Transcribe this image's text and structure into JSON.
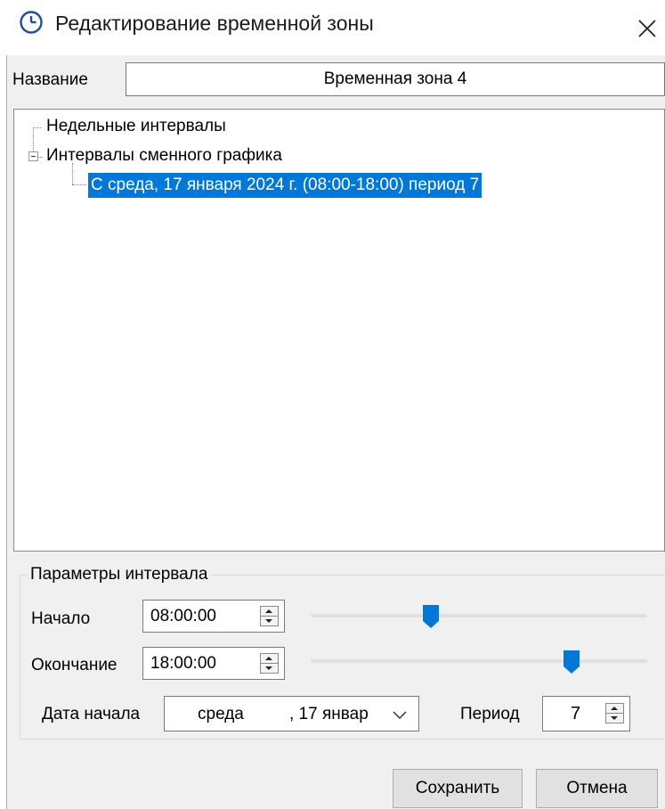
{
  "window": {
    "title": "Редактирование временной зоны",
    "icon": "clock-icon",
    "close_icon": "close-icon"
  },
  "name_field": {
    "label": "Название",
    "value": "Временная зона 4"
  },
  "tree": {
    "nodes": [
      {
        "label": "Недельные интервалы"
      },
      {
        "label": "Интервалы сменного графика",
        "expanded": true
      },
      {
        "label": "С среда, 17 января 2024 г. (08:00-18:00) период 7",
        "selected": true
      }
    ]
  },
  "params": {
    "group_title": "Параметры интервала",
    "start": {
      "label": "Начало",
      "value": "08:00:00",
      "slider_fraction": 0.333
    },
    "end": {
      "label": "Окончание",
      "value": "18:00:00",
      "slider_fraction": 0.75
    },
    "start_date": {
      "label": "Дата начала",
      "weekday": "среда",
      "day_month": ", 17  январ"
    },
    "period": {
      "label": "Период",
      "value": "7"
    }
  },
  "buttons": {
    "save": "Сохранить",
    "cancel": "Отмена"
  },
  "colors": {
    "selection": "#0078d7",
    "slider_thumb": "#0078d7",
    "dialog_background": "#f0f0f0"
  }
}
